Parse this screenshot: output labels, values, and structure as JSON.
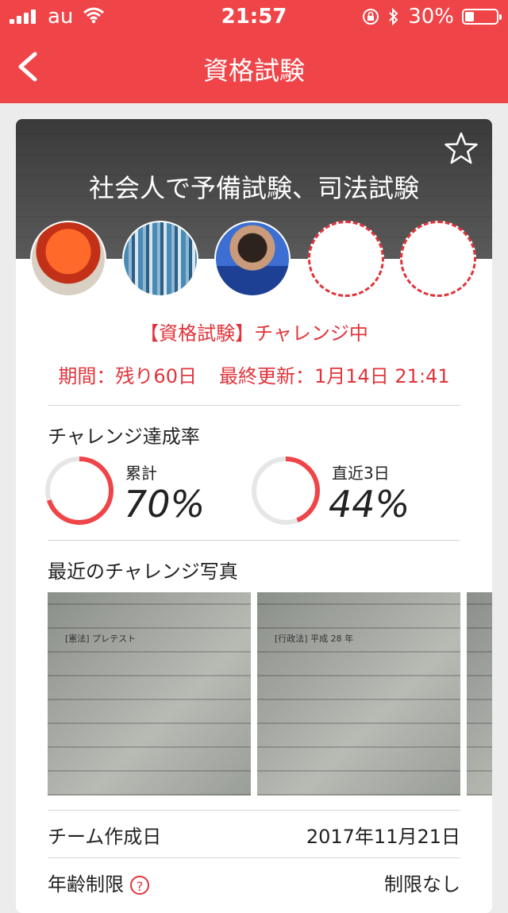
{
  "status_bar": {
    "carrier": "au",
    "time": "21:57",
    "battery": "30%",
    "icons": [
      "signal-icon",
      "wifi-icon",
      "orientation-lock-icon",
      "bluetooth-icon",
      "battery-icon"
    ]
  },
  "nav": {
    "title": "資格試験",
    "back_icon": "chevron-left-icon"
  },
  "team": {
    "name": "社会人で予備試験、司法試験",
    "favorite_icon": "star-outline-icon",
    "members": [
      "filled",
      "filled",
      "filled",
      "empty",
      "empty"
    ],
    "status": "【資格試験】チャレンジ中",
    "period_label": "期間：残り60日",
    "updated_label": "最終更新：1月14日 21:41"
  },
  "rates": {
    "title": "チャレンジ達成率",
    "total": {
      "label": "累計",
      "value": "70%",
      "fraction": 0.7
    },
    "recent": {
      "label": "直近3日",
      "value": "44%",
      "fraction": 0.44
    }
  },
  "photos": {
    "title": "最近のチャレンジ写真",
    "items": [
      {
        "text": "[憲法] プレテスト"
      },
      {
        "text": "[行政法] 平成 28 年"
      },
      {
        "text": ""
      }
    ]
  },
  "info": {
    "created_label": "チーム作成日",
    "created_value": "2017年11月21日",
    "age_label": "年齢制限",
    "age_value": "制限なし",
    "help_glyph": "?"
  },
  "colors": {
    "accent": "#ef4548",
    "text_red": "#e0343b",
    "ring_bg": "#e6e6e6"
  }
}
